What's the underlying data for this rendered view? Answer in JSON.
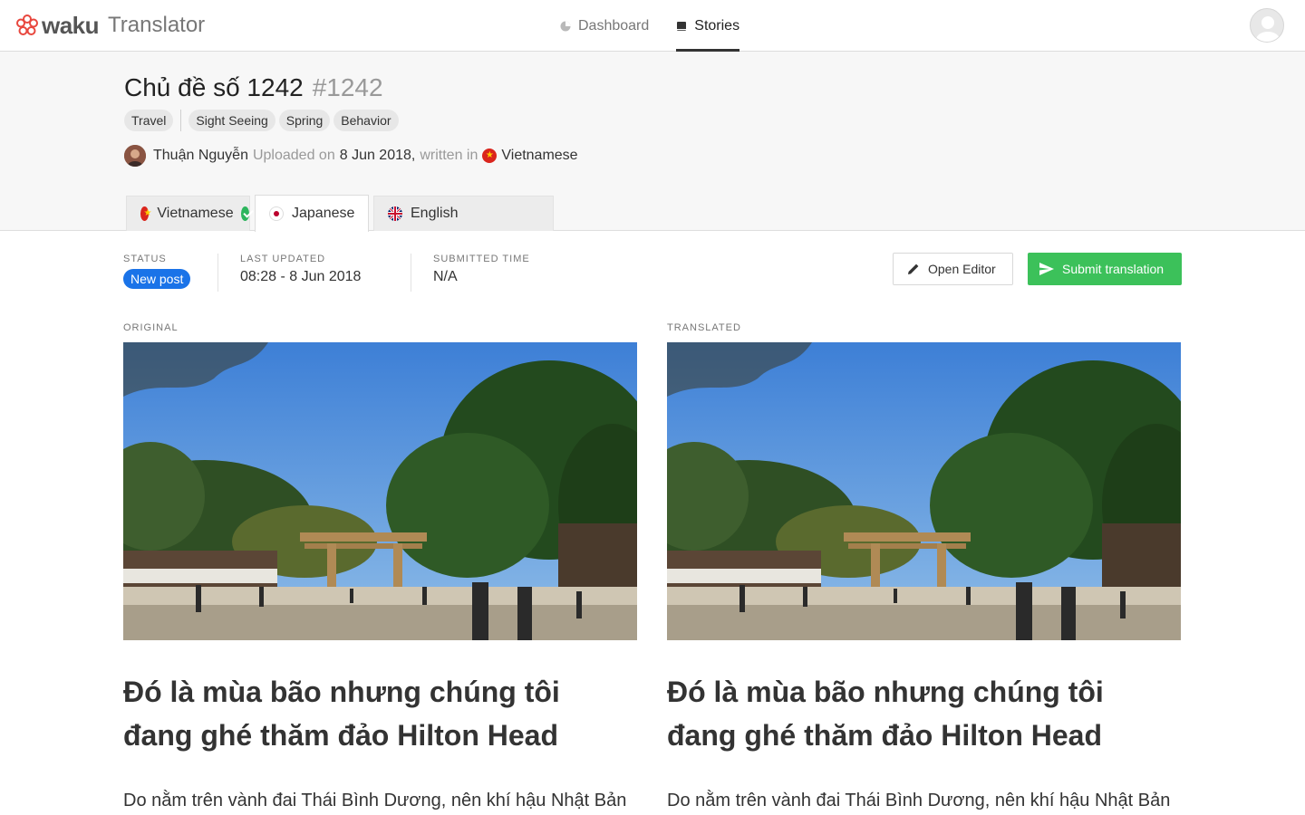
{
  "app": {
    "brand": "waku",
    "product": "Translator"
  },
  "nav": {
    "items": [
      {
        "label": "Dashboard",
        "icon": "pie-chart-icon"
      },
      {
        "label": "Stories",
        "icon": "book-icon"
      }
    ],
    "active": "Stories"
  },
  "story": {
    "title": "Chủ đề số 1242",
    "id_label": "#1242",
    "tags": [
      "Travel",
      "Sight Seeing",
      "Spring",
      "Behavior"
    ],
    "author": "Thuận Nguyễn",
    "uploaded_prefix": "Uploaded on",
    "uploaded_date": "8 Jun 2018,",
    "written_prefix": "written in",
    "written_language": "Vietnamese"
  },
  "language_tabs": [
    {
      "label": "Vietnamese",
      "flag": "vn-flag-icon",
      "done": true
    },
    {
      "label": "Japanese",
      "flag": "jp-flag-icon",
      "active": true
    },
    {
      "label": "English",
      "flag": "uk-flag-icon"
    }
  ],
  "status": {
    "status_label": "STATUS",
    "status_value": "New post",
    "updated_label": "LAST UPDATED",
    "updated_value": "08:28 - 8 Jun 2018",
    "submitted_label": "SUBMITTED TIME",
    "submitted_value": "N/A"
  },
  "actions": {
    "open_editor": "Open Editor",
    "submit": "Submit translation"
  },
  "original": {
    "label": "ORIGINAL",
    "headline": "Đó là mùa bão nhưng chúng tôi đang ghé thăm đảo Hilton Head",
    "paragraph": "Do nằm trên vành đai Thái Bình Dương, nên khí hậu Nhật Bản"
  },
  "translated": {
    "label": "TRANSLATED",
    "headline": "Đó là mùa bão nhưng chúng tôi đang ghé thăm đảo Hilton Head",
    "paragraph": "Do nằm trên vành đai Thái Bình Dương, nên khí hậu Nhật Bản"
  },
  "colors": {
    "accent_blue": "#1a73e8",
    "submit_green": "#3cc15a",
    "check_green": "#2db55d"
  }
}
